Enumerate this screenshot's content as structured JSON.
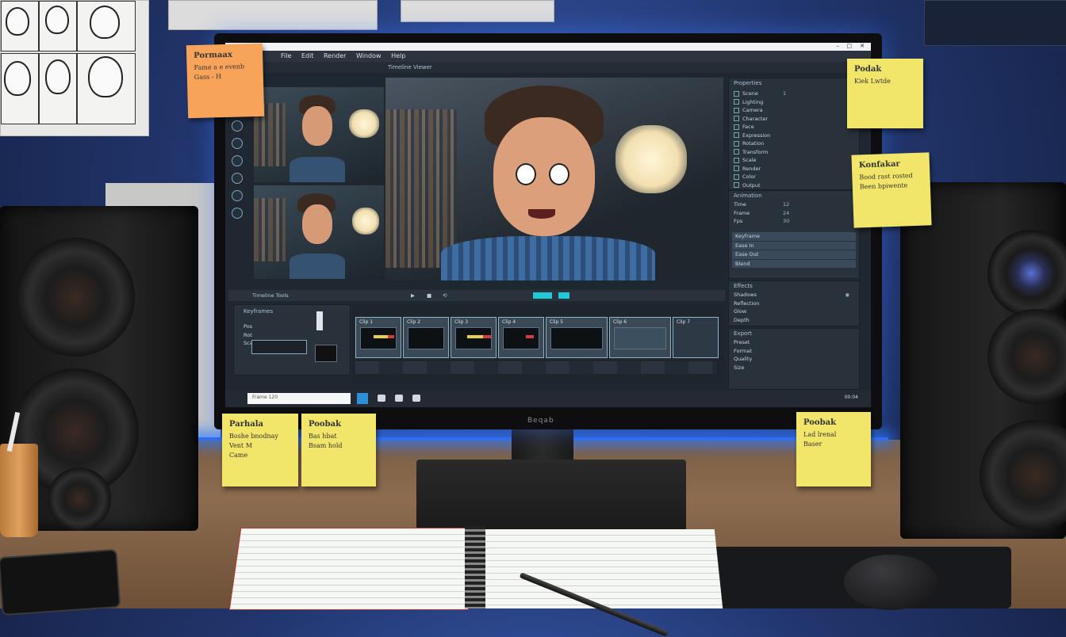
{
  "editor": {
    "menu": [
      "File",
      "Edit",
      "Render",
      "Window",
      "Help"
    ],
    "viewer_title": "Timeline Viewer",
    "right_panel_title": "Properties",
    "layers": [
      {
        "name": "Scene",
        "val": "1"
      },
      {
        "name": "Lighting",
        "val": ""
      },
      {
        "name": "Camera",
        "val": ""
      },
      {
        "name": "Character",
        "val": ""
      },
      {
        "name": "Face",
        "val": ""
      },
      {
        "name": "Expression",
        "val": ""
      },
      {
        "name": "Rotation",
        "val": ""
      },
      {
        "name": "Transform",
        "val": ""
      },
      {
        "name": "Scale",
        "val": ""
      },
      {
        "name": "Render",
        "val": ""
      },
      {
        "name": "Color",
        "val": ""
      },
      {
        "name": "Output",
        "val": ""
      }
    ],
    "section_a_title": "Animation",
    "section_a_rows": [
      {
        "name": "Time",
        "val": "12"
      },
      {
        "name": "Frame",
        "val": "24"
      },
      {
        "name": "Fps",
        "val": "30"
      }
    ],
    "section_b_rows": [
      "Keyframe",
      "Ease In",
      "Ease Out",
      "Blend"
    ],
    "section_c_title": "Effects",
    "section_c_rows": [
      "Shadows",
      "Reflection",
      "Glow",
      "Depth"
    ],
    "section_d_title": "Export",
    "section_d_rows": [
      "Preset",
      "Format",
      "Quality",
      "Size"
    ],
    "timeline_toolbar": "Timeline Tools",
    "timeline_left_title": "Keyframes",
    "timeline_left_rows": [
      "Pos",
      "Rot",
      "Scale"
    ],
    "clip_labels": [
      "Clip 1",
      "Clip 2",
      "Clip 3",
      "Clip 4",
      "Clip 5",
      "Clip 6",
      "Clip 7"
    ],
    "status_left": "Frame 120",
    "status_right": "00:04"
  },
  "monitor_brand": "Beqab",
  "sticky_notes": [
    {
      "title": "Pormaax",
      "body": "Fame a e evenb\nGass - H",
      "color": "orange"
    },
    {
      "title": "Podak",
      "body": "Kiek Lwtde",
      "color": "yellow"
    },
    {
      "title": "Konfakar",
      "body": "Bood rast rosted\nBeen bpiwente",
      "color": "yellow"
    },
    {
      "title": "Parhala",
      "body": "Boshe bnodnay\nVent M\nCame",
      "color": "yellow"
    },
    {
      "title": "Poobak",
      "body": "Bas hbat\nBsam hold",
      "color": "yellow"
    },
    {
      "title": "Poobak",
      "body": "Lad lrenal\nBaser",
      "color": "yellow"
    }
  ]
}
